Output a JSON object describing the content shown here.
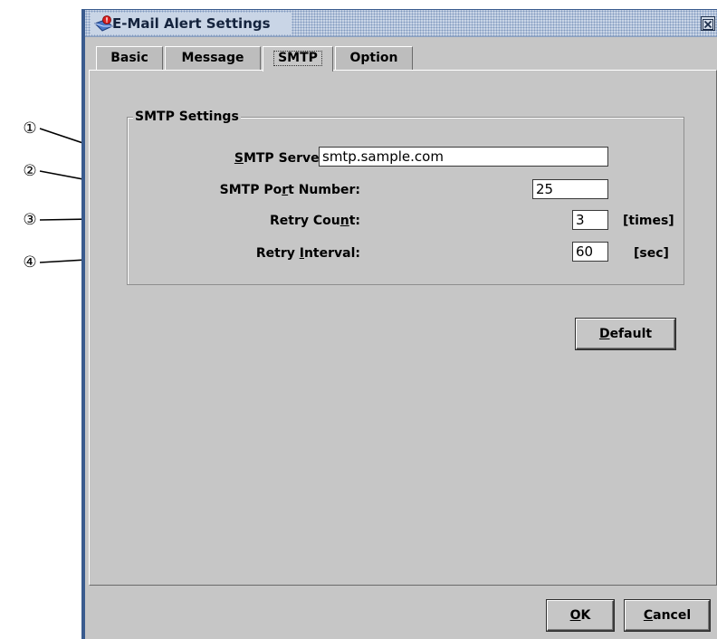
{
  "callouts": [
    "①",
    "②",
    "③",
    "④"
  ],
  "window": {
    "title": "E-Mail Alert Settings",
    "icon": "mail-alert-icon",
    "close_icon": "close-icon"
  },
  "tabs": [
    {
      "label": "Basic",
      "active": false
    },
    {
      "label": "Message",
      "active": false
    },
    {
      "label": "SMTP",
      "active": true
    },
    {
      "label": "Option",
      "active": false
    }
  ],
  "smtp": {
    "group_title": "SMTP Settings",
    "server_address_label_pre": "",
    "server_address_label_u": "S",
    "server_address_label_post": "MTP Server Address:",
    "server_address_value": "smtp.sample.com",
    "port_label_pre": "SMTP Po",
    "port_label_u": "r",
    "port_label_post": "t Number:",
    "port_value": "25",
    "retry_count_label_pre": "Retry Cou",
    "retry_count_label_u": "n",
    "retry_count_label_post": "t:",
    "retry_count_value": "3",
    "retry_count_unit": "[times]",
    "retry_interval_label_pre": "Retry ",
    "retry_interval_label_u": "I",
    "retry_interval_label_post": "nterval:",
    "retry_interval_value": "60",
    "retry_interval_unit": "[sec]"
  },
  "buttons": {
    "default_u": "D",
    "default_rest": "efault",
    "ok_u": "O",
    "ok_rest": "K",
    "cancel_u": "C",
    "cancel_rest": "ancel"
  },
  "colors": {
    "window_bg": "#c6c6c6",
    "frame_accent": "#3a5b8e",
    "title_text": "#14233d"
  }
}
